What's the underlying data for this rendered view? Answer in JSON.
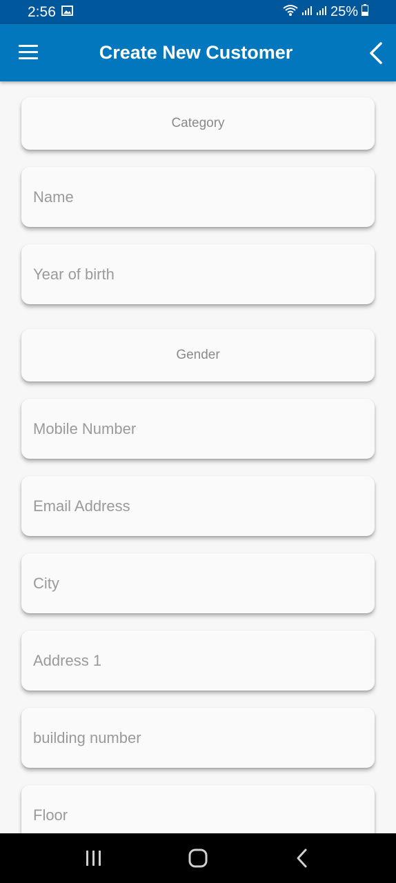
{
  "status_bar": {
    "time": "2:56",
    "battery": "25%",
    "icons": [
      "image-icon",
      "wifi-icon",
      "signal-icon",
      "signal-icon",
      "battery-icon"
    ]
  },
  "app_bar": {
    "title": "Create New Customer",
    "background": "#0277bd",
    "left_icon": "menu-icon",
    "right_icon": "back-arrow-icon"
  },
  "form": {
    "category": "Category",
    "name": "Name",
    "year_of_birth": "Year of birth",
    "gender": "Gender",
    "mobile_number": "Mobile Number",
    "email_address": "Email Address",
    "city": "City",
    "address_1": "Address 1",
    "building_number": "building number",
    "floor": "Floor"
  },
  "nav_bar": {
    "icons": [
      "recent-apps-icon",
      "home-icon",
      "back-icon"
    ]
  }
}
